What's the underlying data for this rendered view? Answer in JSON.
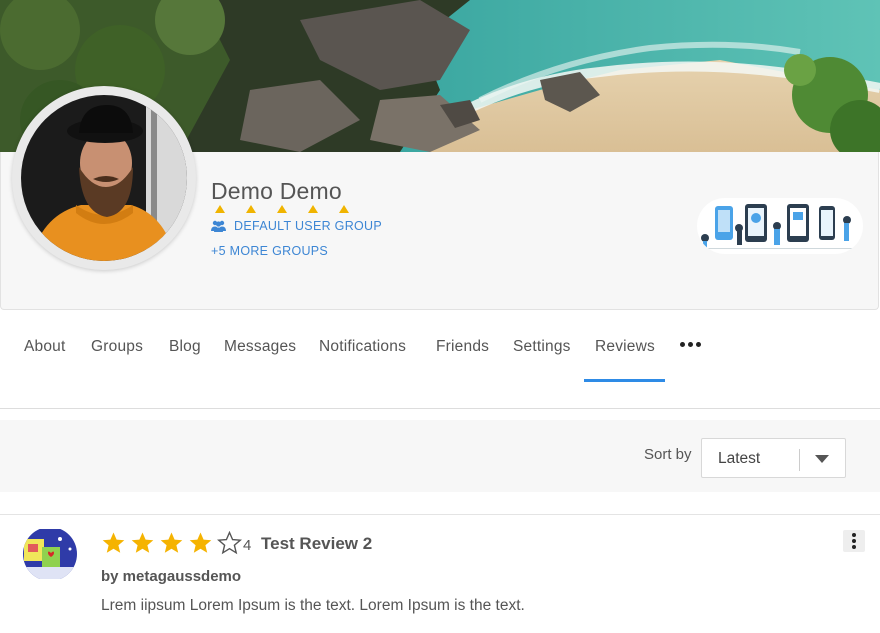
{
  "profile": {
    "display_name": "Demo Demo",
    "rank_stars": 5,
    "group_icon": "users-icon",
    "group_name": "DEFAULT USER GROUP",
    "more_groups": "+5 MORE GROUPS"
  },
  "tabs": [
    {
      "label": "About"
    },
    {
      "label": "Groups"
    },
    {
      "label": "Blog"
    },
    {
      "label": "Messages"
    },
    {
      "label": "Notifications"
    },
    {
      "label": "Friends"
    },
    {
      "label": "Settings"
    },
    {
      "label": "Reviews",
      "active": true
    }
  ],
  "more_menu_icon": "more-horizontal-icon",
  "sort": {
    "label": "Sort by",
    "selected": "Latest"
  },
  "review": {
    "rating": 4,
    "max_rating": 5,
    "rating_text": "4",
    "title": "Test Review 2",
    "author": "by metagaussdemo",
    "text": "Lrem iipsum Lorem Ipsum is the text. Lorem Ipsum is the text.",
    "menu_icon": "more-vertical-icon"
  },
  "colors": {
    "accent": "#2e8be6",
    "link": "#3d86d4",
    "star": "#f5b301"
  }
}
